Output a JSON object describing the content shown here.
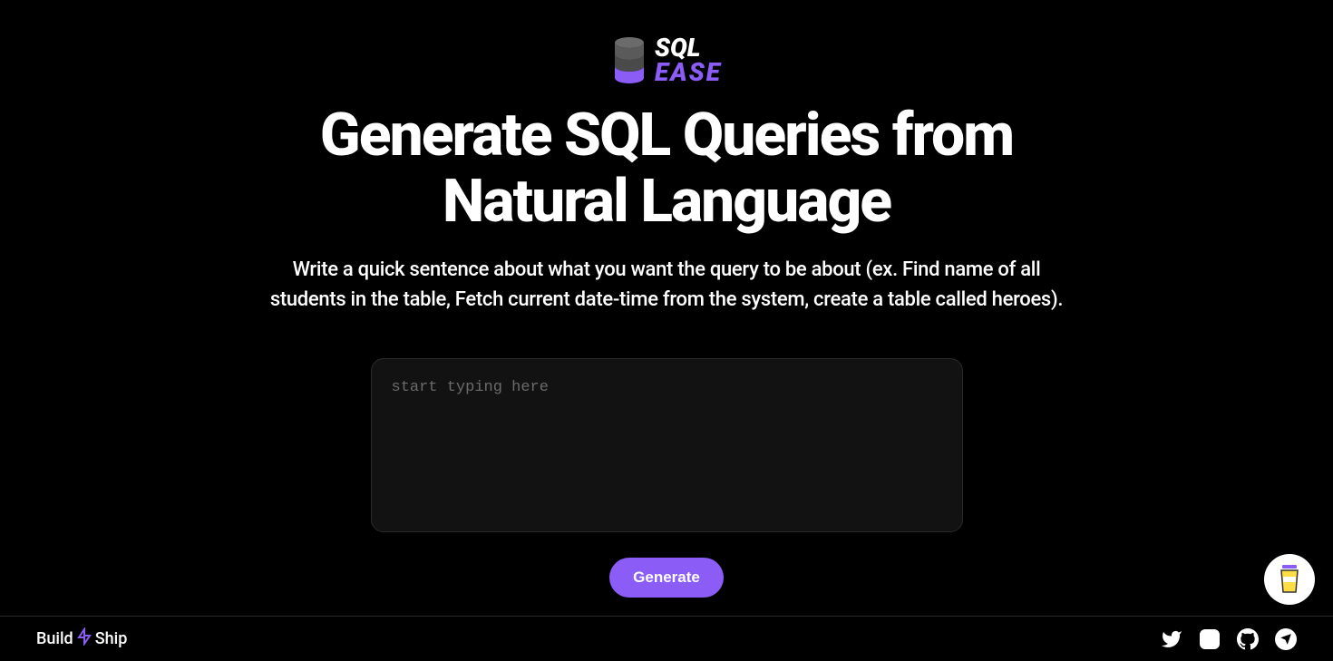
{
  "logo": {
    "text_top": "SQL",
    "text_bottom": "EASE"
  },
  "headline": "Generate SQL Queries from Natural Language",
  "subtitle": "Write a quick sentence about what you want the query to be about (ex. Find name of all students in the table, Fetch current date-time from the system, create a table called heroes).",
  "input": {
    "placeholder": "start typing here",
    "value": ""
  },
  "generate_button": "Generate",
  "footer": {
    "brand_prefix": "Build",
    "brand_suffix": "Ship"
  },
  "colors": {
    "accent": "#8b5cf6",
    "background": "#000000"
  }
}
